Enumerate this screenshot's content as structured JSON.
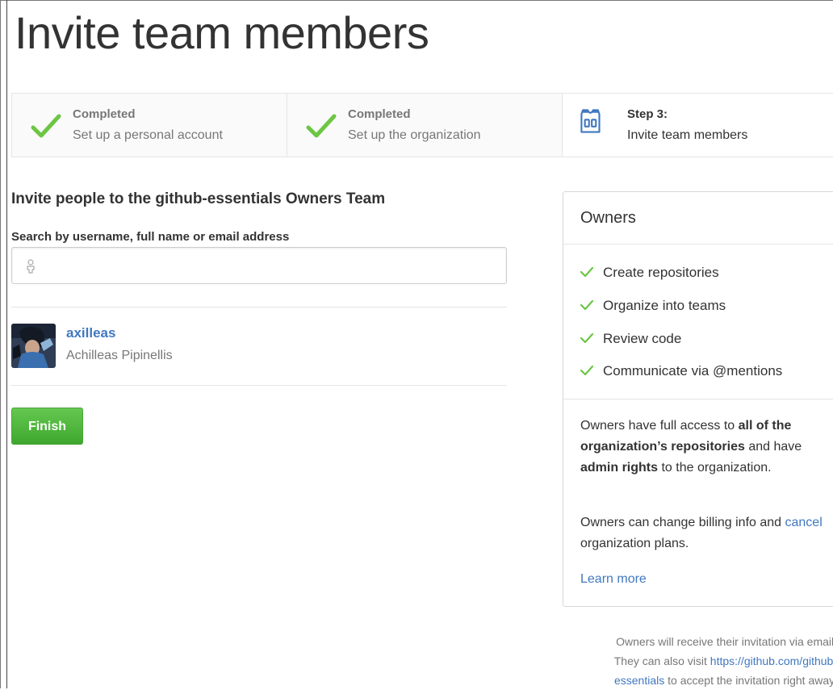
{
  "page_title": "Invite team members",
  "steps": [
    {
      "title": "Completed",
      "subtitle": "Set up a personal account",
      "icon": "check-icon"
    },
    {
      "title": "Completed",
      "subtitle": "Set up the organization",
      "icon": "check-icon"
    },
    {
      "title": "Step 3:",
      "subtitle": "Invite team members",
      "icon": "jersey-icon"
    }
  ],
  "invite": {
    "heading": "Invite people to the github-essentials Owners Team",
    "search_label": "Search by username, full name or email address",
    "search_value": "",
    "search_placeholder": ""
  },
  "members": [
    {
      "username": "axilleas",
      "full_name": "Achilleas Pipinellis"
    }
  ],
  "finish_label": "Finish",
  "owners": {
    "title": "Owners",
    "permissions": [
      "Create repositories",
      "Organize into teams",
      "Review code",
      "Communicate via @mentions"
    ],
    "desc_a": "Owners have full access to ",
    "desc_b": "all of the organization’s repositories",
    "desc_c": " and have ",
    "desc_d": "admin rights",
    "desc_e": " to the organization.",
    "billing_a": "Owners can change billing info and ",
    "billing_link": "cancel",
    "billing_b": " organization plans.",
    "learn_more": "Learn more"
  },
  "footnote": {
    "line1": "Owners will receive their invitation via email.",
    "line2_a": "They can also visit ",
    "line2_link": "https://github.com/github-essentials",
    "line2_b": " to accept the invitation right away."
  },
  "colors": {
    "accent_link": "#4078c0",
    "check_green": "#6cc644",
    "finish_green": "#55a532"
  }
}
